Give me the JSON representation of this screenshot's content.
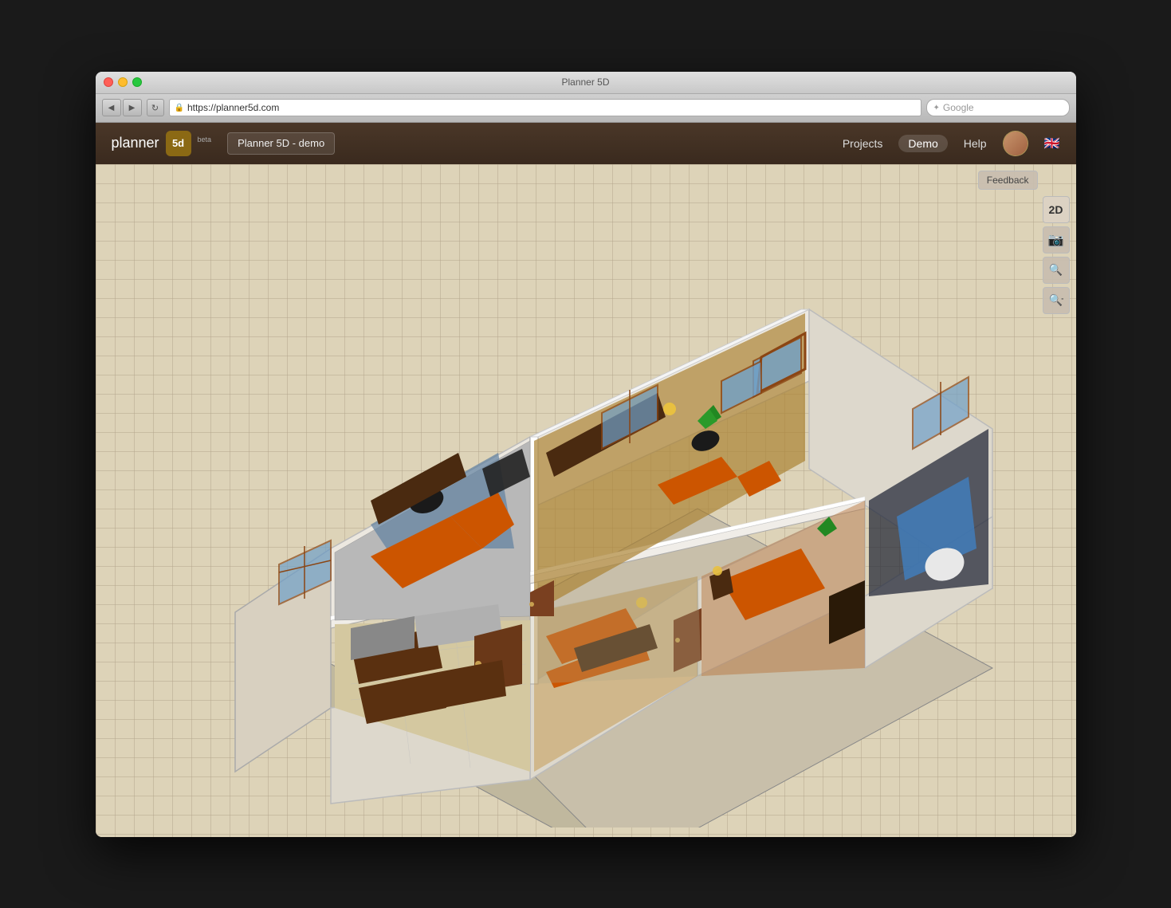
{
  "window": {
    "title": "Planner 5D",
    "url": "https://planner5d.com"
  },
  "browser": {
    "back_label": "◀",
    "forward_label": "▶",
    "reload_label": "↻",
    "address": "https://planner5d.com",
    "search_placeholder": "Google"
  },
  "header": {
    "logo_text": "planner",
    "logo_icon": "5d",
    "beta_label": "beta",
    "project_name": "Planner 5D - demo",
    "nav": {
      "projects_label": "Projects",
      "demo_label": "Demo",
      "help_label": "Help"
    }
  },
  "toolbar": {
    "feedback_label": "Feedback",
    "view_2d_label": "2D",
    "screenshot_label": "📷",
    "zoom_in_label": "🔍+",
    "zoom_out_label": "🔍-"
  },
  "floorplan": {
    "description": "3D isometric view of apartment floor plan with multiple rooms"
  }
}
